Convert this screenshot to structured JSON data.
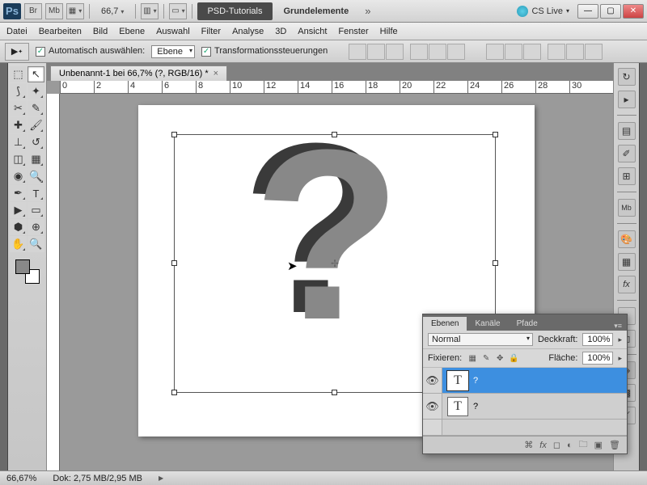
{
  "topbar": {
    "ps": "Ps",
    "br": "Br",
    "mb": "Mb",
    "zoom": "66,7",
    "tab_tutorials": "PSD-Tutorials",
    "tab_elements": "Grundelemente",
    "cs_live": "CS Live"
  },
  "menu": [
    "Datei",
    "Bearbeiten",
    "Bild",
    "Ebene",
    "Auswahl",
    "Filter",
    "Analyse",
    "3D",
    "Ansicht",
    "Fenster",
    "Hilfe"
  ],
  "options": {
    "auto_select": "Automatisch auswählen:",
    "auto_select_value": "Ebene",
    "transform_controls": "Transformationssteuerungen"
  },
  "document": {
    "tab_title": "Unbenannt-1 bei 66,7% (?, RGB/16) *",
    "ruler_marks": [
      0,
      2,
      4,
      6,
      8,
      10,
      12,
      14,
      16,
      18,
      20,
      22,
      24,
      26,
      28,
      30
    ],
    "content_char": "?"
  },
  "layers_panel": {
    "tabs": [
      "Ebenen",
      "Kanäle",
      "Pfade"
    ],
    "blend_mode": "Normal",
    "opacity_label": "Deckkraft:",
    "opacity": "100%",
    "lock_label": "Fixieren:",
    "fill_label": "Fläche:",
    "fill": "100%",
    "layers": [
      {
        "name": "?",
        "selected": true,
        "thumb": "T"
      },
      {
        "name": "?",
        "selected": false,
        "thumb": "T"
      }
    ]
  },
  "status": {
    "zoom": "66,67%",
    "doc_info": "Dok: 2,75 MB/2,95 MB"
  }
}
